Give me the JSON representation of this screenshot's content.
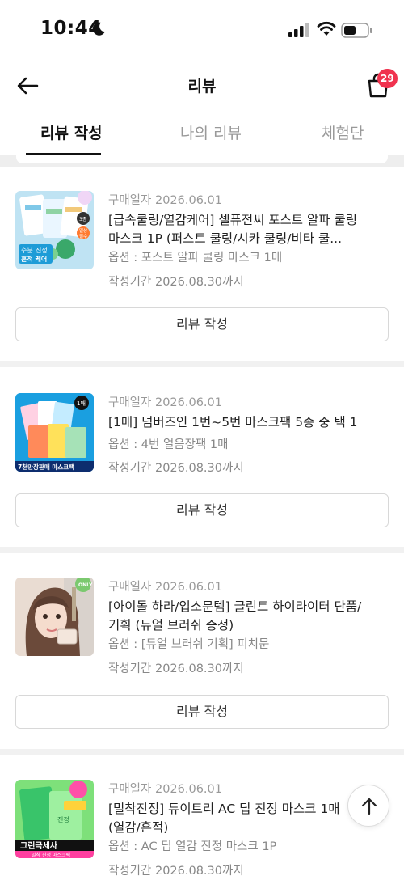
{
  "status_bar": {
    "time": "10:44"
  },
  "header": {
    "title": "리뷰",
    "cart_count": "29"
  },
  "tabs": [
    {
      "label": "리뷰 작성",
      "active": true
    },
    {
      "label": "나의 리뷰",
      "active": false
    },
    {
      "label": "체험단",
      "active": false
    }
  ],
  "reviews": [
    {
      "purchase_date": "구매일자 2026.06.01",
      "product_name": "[급속쿨링/열감케어] 셀퓨전씨 포스트 알파 쿨링 마스크 1P (퍼스트 쿨링/시카 쿨링/비타 쿨...",
      "option": "옵션 : 포스트 알파 쿨링 마스크 1매",
      "deadline": "작성기간 2026.08.30까지",
      "button_label": "리뷰 작성",
      "thumb_text": [
        "수분",
        "진정",
        "흔적 케어",
        "3종",
        "일상",
        "필수"
      ]
    },
    {
      "purchase_date": "구매일자 2026.06.01",
      "product_name": "[1매] 넘버즈인 1번~5번 마스크팩 5종 중 택 1",
      "option": "옵션 : 4번 얼음장팩 1매",
      "deadline": "작성기간 2026.08.30까지",
      "button_label": "리뷰 작성",
      "thumb_text": [
        "1매",
        "7천만장판매 마스크팩"
      ]
    },
    {
      "purchase_date": "구매일자 2026.06.01",
      "product_name": "[아이돌 하라/입소문템] 글린트 하이라이터 단품/기획 (듀얼 브러쉬 증정)",
      "option": "옵션 : [듀얼 브러쉬 기획] 피치문",
      "deadline": "작성기간 2026.08.30까지",
      "button_label": "리뷰 작성",
      "thumb_text": [
        "ONLY"
      ]
    },
    {
      "purchase_date": "구매일자 2026.06.01",
      "product_name": "[밀착진정] 듀이트리 AC 딥 진정 마스크 1매 (열감/흔적)",
      "option": "옵션 : AC 딥 열감 진정 마스크 1P",
      "deadline": "작성기간 2026.08.30까지",
      "button_label": "리뷰 작성",
      "thumb_text": [
        "그린극세사",
        "밀착 진정 마스크팩",
        "진정"
      ]
    }
  ],
  "colors": {
    "badge": "#f0334f",
    "active_tab": "#111111",
    "muted_text": "#999999"
  },
  "icons": [
    "moon-icon",
    "signal-icon",
    "wifi-icon",
    "battery-icon",
    "back-arrow-icon",
    "shopping-bag-icon",
    "arrow-up-icon"
  ]
}
